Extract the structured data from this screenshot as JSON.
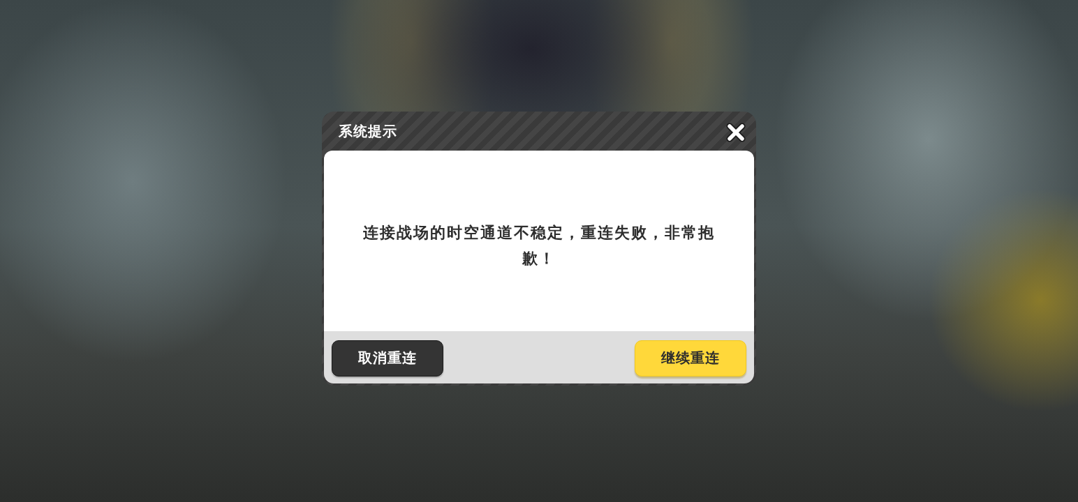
{
  "dialog": {
    "title": "系统提示",
    "message": "连接战场的时空通道不稳定，重连失败，非常抱歉！",
    "buttons": [
      {
        "label": "取消重连",
        "kind": "secondary"
      },
      {
        "label": "继续重连",
        "kind": "primary"
      }
    ]
  }
}
